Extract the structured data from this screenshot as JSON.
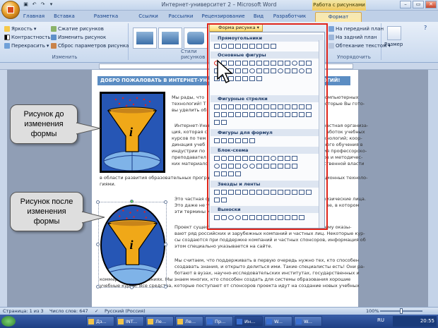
{
  "window": {
    "title": "Интернет-университет 2 – Microsoft Word",
    "tools_tab": "Работа с рисунками"
  },
  "tabs": [
    {
      "label": "Главная"
    },
    {
      "label": "Вставка"
    },
    {
      "label": "Разметка страницы"
    },
    {
      "label": "Ссылки"
    },
    {
      "label": "Рассылки"
    },
    {
      "label": "Рецензирование"
    },
    {
      "label": "Вид"
    },
    {
      "label": "Разработчик"
    },
    {
      "label": "Формат"
    }
  ],
  "ribbon": {
    "change_group": {
      "label": "Изменить",
      "brightness": "Яркость",
      "contrast": "Контрастность",
      "recolor": "Перекрасить",
      "compress": "Сжатие рисунков",
      "change_picture": "Изменить рисунок",
      "reset": "Сброс параметров рисунка"
    },
    "styles_group": {
      "label": "Стили рисунков"
    },
    "shape_button": "Форма рисунка",
    "arrange": {
      "bring_forward": "На передний план",
      "send_backward": "На задний план",
      "text_wrap": "Обтекание текстом",
      "label": "Упорядочить"
    },
    "size_label": "Размер"
  },
  "document": {
    "banner": "ДОБРО ПОЖАЛОВАТЬ В ИНТЕРНЕТ-УНИВЕРСИТЕТ ИНФОРМАЦИОННЫХ ТЕХНОЛОГИЙ!",
    "p1a": "Мы рады, что",
    "p1b": "компьютерных",
    "p1c": "технологий! Т",
    "p1d": "которые Вы гото-",
    "p1e": "вы уделить об",
    "p2a": "Интернет-Унив",
    "p2b": "частная организа-",
    "p2c": "ция, которая с",
    "p2d": "аботок учебных",
    "p2e": "курсов по тем",
    "p2f": "хнологий; коор-",
    "p2g": "динация учеб",
    "p2h": "ного обучения в",
    "p2i": "индустрии по",
    "p2j": "ия профессорско-",
    "p2k": "преподавател",
    "p2l": "ов и методичес-",
    "p2m": "ких материало",
    "p2n": "ственной власти",
    "p2o": "в области развития образовательных програм",
    "p2p": "ционных техноло-",
    "p2q": "гиями.",
    "p3a": "Это частная ор",
    "p3b": "физические лица.",
    "p3c": "Это даже не уч",
    "p3d": "ве, в котором",
    "p3e": "эти термины из",
    "p4": "Проект существует на средства, предоставленные компаниями, поддерживающими ему оказы-вают ряд российских и зарубежных компаний и частных лиц. Некоторые кур-сы создаются при поддержке компаний и частных спонсоров, информация об этом специально указывается на сайте.",
    "p4a": "Проект существ",
    "p4b": "ржку ему оказы-",
    "p4c": "вают ряд российских и зарубежных компаний и частных лиц. Некоторые кур-",
    "p4d": "сы создаются при поддержке компаний и частных спонсоров, информация об",
    "p4e": "этом специально указывается на сайте.",
    "p5a": "Мы считаем, что поддерживать в первую очередь нужно тех, кто способен",
    "p5b": "создавать знания, и открыто делиться ими. Такие специалисты есть! Они ра-",
    "p5c": "ботают в вузах, научно-исследовательских институтах, государственных и",
    "p5d": "коммерческих компаниях. Мы знаем многих, кто способен создать для системы образования хорошие",
    "p5e": "учебные курсы. Все средства, которые поступают от спонсоров проекта идут на создание новых учебных"
  },
  "callouts": {
    "before": "Рисунок до изменения формы",
    "after": "Рисунок после изменения формы"
  },
  "callouts_lines": {
    "before": [
      "Рисунок до",
      "изменения",
      "формы"
    ],
    "after": [
      "Рисунок после",
      "изменения",
      "формы"
    ]
  },
  "shapes_panel": {
    "sections": [
      "Прямоугольники",
      "Основные фигуры",
      "Фигурные стрелки",
      "Фигуры для формул",
      "Блок-схема",
      "Звезды и ленты",
      "Выноски"
    ]
  },
  "status": {
    "page": "Страница: 1 из 3",
    "words": "Число слов: 647",
    "language": "Русский (Россия)",
    "zoom": "100%"
  },
  "taskbar": {
    "items": [
      "Дз...",
      "INT...",
      "Ле...",
      "Ле...",
      "Пр...",
      "Ин...",
      "W...",
      "W..."
    ],
    "lang": "RU",
    "clock": "20:55"
  },
  "colors": {
    "accent": "#e0251b",
    "banner": "#5b8dc3",
    "picture_bg": "#2656b5",
    "funnel": "#f0a818"
  }
}
